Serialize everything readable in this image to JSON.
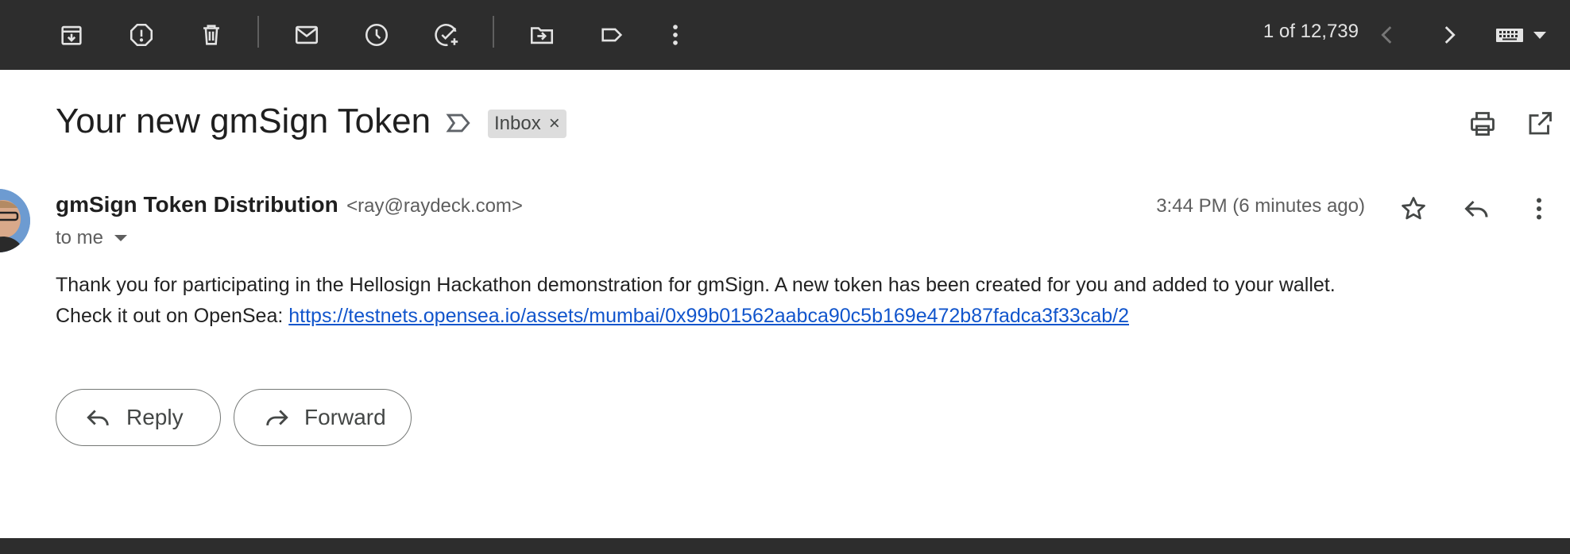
{
  "toolbar": {
    "actions": [
      "archive-icon",
      "report-spam-icon",
      "delete-icon",
      "mark-unread-icon",
      "snooze-icon",
      "add-task-icon",
      "move-to-icon",
      "label-icon",
      "more-vert-icon"
    ],
    "pager_text": "1 of 12,739"
  },
  "email": {
    "subject": "Your new gmSign Token",
    "label_chip": "Inbox",
    "label_chip_remove": "×",
    "sender_name": "gmSign Token Distribution",
    "sender_email": "<ray@raydeck.com>",
    "recipient": "to me",
    "timestamp": "3:44 PM (6 minutes ago)",
    "body_line1": "Thank you for participating in the Hellosign Hackathon demonstration for gmSign. A new token has been created for you and added to your wallet.",
    "body_line2_prefix": "Check it out on OpenSea: ",
    "body_link": "https://testnets.opensea.io/assets/mumbai/0x99b01562aabca90c5b169e472b87fadca3f33cab/2"
  },
  "actions": {
    "reply_label": "Reply",
    "forward_label": "Forward"
  },
  "colors": {
    "toolbar_bg": "#2d2d2d",
    "link": "#1155cc",
    "chip_bg": "#dddddd"
  }
}
